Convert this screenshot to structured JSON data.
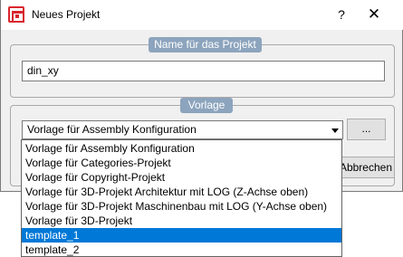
{
  "window": {
    "title": "Neues Projekt",
    "help_label": "?",
    "close_label": "✕"
  },
  "name_group": {
    "legend": "Name für das Projekt",
    "value": "din_xy"
  },
  "template_group": {
    "legend": "Vorlage",
    "selected_value": "Vorlage für Assembly Konfiguration",
    "browse_label": "...",
    "highlighted_option": "template_1",
    "options": [
      "Vorlage für Assembly Konfiguration",
      "Vorlage für Categories-Projekt",
      "Vorlage für Copyright-Projekt",
      "Vorlage für 3D-Projekt Architektur mit LOG (Z-Achse oben)",
      "Vorlage für 3D-Projekt Maschinenbau mit LOG (Y-Achse oben)",
      "Vorlage für 3D-Projekt",
      "template_1",
      "template_2"
    ]
  },
  "footer": {
    "cancel_label": "Abbrechen"
  },
  "colors": {
    "accent": "#0078d7",
    "legend_bg": "#8ca4bd",
    "brand": "#d8262d"
  }
}
